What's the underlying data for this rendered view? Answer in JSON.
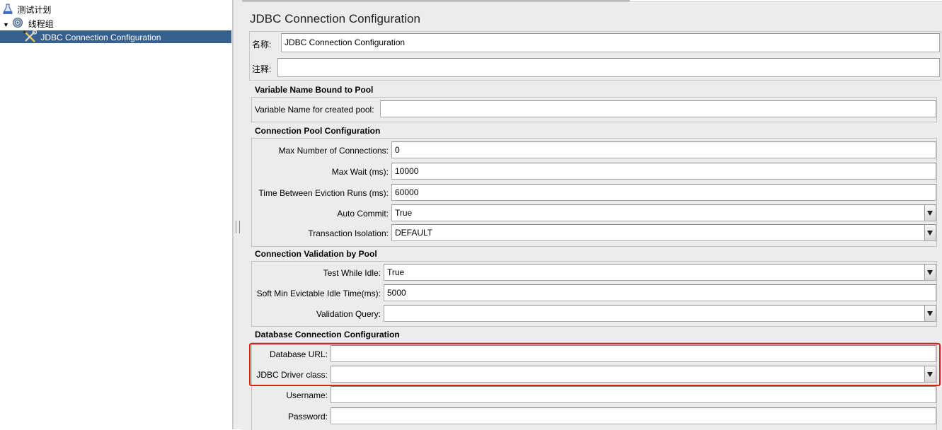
{
  "tree": {
    "items": [
      {
        "label": "测试计划",
        "icon": "flask-icon"
      },
      {
        "label": "线程组",
        "icon": "gear-icon",
        "expander": "▼"
      },
      {
        "label": "JDBC Connection Configuration",
        "icon": "wrench-screwdriver-icon",
        "selected": true
      }
    ]
  },
  "panel": {
    "title": "JDBC Connection Configuration",
    "name_label": "名称:",
    "name_value": "JDBC Connection Configuration",
    "comment_label": "注释:",
    "comment_value": ""
  },
  "variable_pool": {
    "section_title": "Variable Name Bound to Pool",
    "label": "Variable Name for created pool:",
    "value": ""
  },
  "pool_config": {
    "section_title": "Connection Pool Configuration",
    "max_connections_label": "Max Number of Connections:",
    "max_connections_value": "0",
    "max_wait_label": "Max Wait (ms):",
    "max_wait_value": "10000",
    "eviction_label": "Time Between Eviction Runs (ms):",
    "eviction_value": "60000",
    "auto_commit_label": "Auto Commit:",
    "auto_commit_value": "True",
    "isolation_label": "Transaction Isolation:",
    "isolation_value": "DEFAULT"
  },
  "validation": {
    "section_title": "Connection Validation by Pool",
    "test_idle_label": "Test While Idle:",
    "test_idle_value": "True",
    "soft_min_label": "Soft Min Evictable Idle Time(ms):",
    "soft_min_value": "5000",
    "query_label": "Validation Query:",
    "query_value": ""
  },
  "db_config": {
    "section_title": "Database Connection Configuration",
    "url_label": "Database URL:",
    "url_value": "",
    "driver_label": "JDBC Driver class:",
    "driver_value": "",
    "username_label": "Username:",
    "username_value": "",
    "password_label": "Password:",
    "password_value": ""
  },
  "colors": {
    "selection": "#37608f",
    "highlight_border": "#e21b1b",
    "panel_bg": "#ececec"
  }
}
